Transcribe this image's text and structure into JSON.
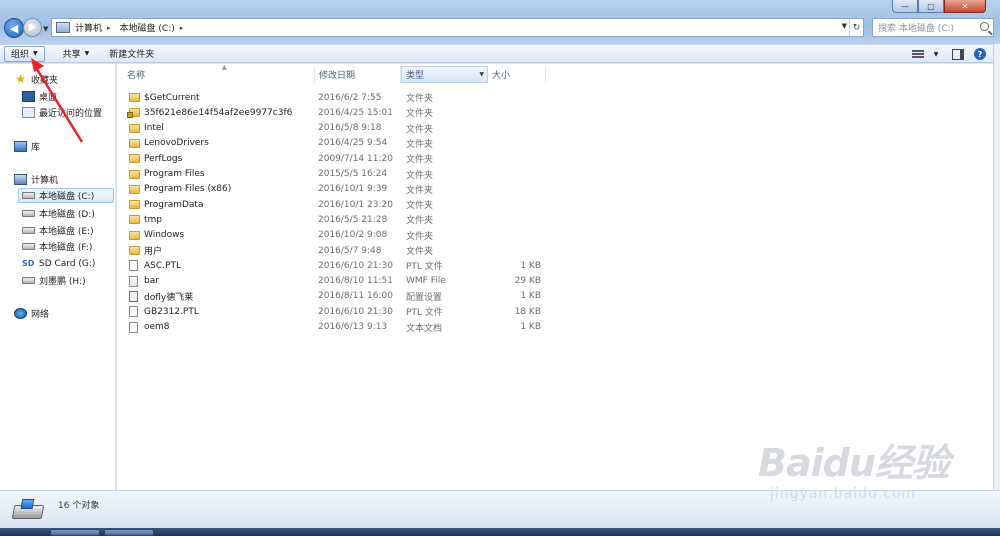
{
  "window": {
    "caption_min": "—",
    "caption_max": "□",
    "caption_close": "✕"
  },
  "nav": {
    "back": "◀",
    "forward": "▶",
    "dropdown": "▼"
  },
  "address": {
    "crumbs": [
      "计算机",
      "本地磁盘 (C:)"
    ],
    "separator": "▸",
    "dropdown": "▼",
    "refresh": "↻"
  },
  "search": {
    "placeholder": "搜索 本地磁盘 (C:)"
  },
  "toolbar": {
    "organize": "组织",
    "share": "共享",
    "new_folder": "新建文件夹",
    "caret": "▼",
    "help": "?"
  },
  "sidebar": {
    "favorites": "收藏夹",
    "desktop": "桌面",
    "recent": "最近访问的位置",
    "library": "库",
    "computer": "计算机",
    "drives": [
      "本地磁盘 (C:)",
      "本地磁盘 (D:)",
      "本地磁盘 (E:)",
      "本地磁盘 (F:)",
      "SD Card (G:)",
      "刘墨鹏 (H:)"
    ],
    "sd_mark": "SD",
    "network": "网络"
  },
  "columns": {
    "name": "名称",
    "date": "修改日期",
    "type": "类型",
    "size": "大小",
    "sort_indicator": "▲",
    "caret": "▼"
  },
  "files": [
    {
      "name": "$GetCurrent",
      "date": "2016/6/2 7:55",
      "type": "文件夹",
      "size": "",
      "kind": "folder"
    },
    {
      "name": "35f621e86e14f54af2ee9977c3f6",
      "date": "2016/4/25 15:01",
      "type": "文件夹",
      "size": "",
      "kind": "folder-lock"
    },
    {
      "name": "Intel",
      "date": "2016/5/8 9:18",
      "type": "文件夹",
      "size": "",
      "kind": "folder"
    },
    {
      "name": "LenovoDrivers",
      "date": "2016/4/25 9:54",
      "type": "文件夹",
      "size": "",
      "kind": "folder"
    },
    {
      "name": "PerfLogs",
      "date": "2009/7/14 11:20",
      "type": "文件夹",
      "size": "",
      "kind": "folder"
    },
    {
      "name": "Program Files",
      "date": "2015/5/5 16:24",
      "type": "文件夹",
      "size": "",
      "kind": "folder"
    },
    {
      "name": "Program Files (x86)",
      "date": "2016/10/1 9:39",
      "type": "文件夹",
      "size": "",
      "kind": "folder"
    },
    {
      "name": "ProgramData",
      "date": "2016/10/1 23:20",
      "type": "文件夹",
      "size": "",
      "kind": "folder"
    },
    {
      "name": "tmp",
      "date": "2016/5/5 21:28",
      "type": "文件夹",
      "size": "",
      "kind": "folder"
    },
    {
      "name": "Windows",
      "date": "2016/10/2 9:08",
      "type": "文件夹",
      "size": "",
      "kind": "folder"
    },
    {
      "name": "用户",
      "date": "2016/5/7 9:48",
      "type": "文件夹",
      "size": "",
      "kind": "folder"
    },
    {
      "name": "ASC.PTL",
      "date": "2016/6/10 21:30",
      "type": "PTL 文件",
      "size": "1 KB",
      "kind": "file"
    },
    {
      "name": "bar",
      "date": "2016/8/10 11:51",
      "type": "WMF File",
      "size": "29 KB",
      "kind": "wmf"
    },
    {
      "name": "dofly德飞莱",
      "date": "2016/8/11 16:00",
      "type": "配置设置",
      "size": "1 KB",
      "kind": "cfg"
    },
    {
      "name": "GB2312.PTL",
      "date": "2016/6/10 21:30",
      "type": "PTL 文件",
      "size": "18 KB",
      "kind": "file"
    },
    {
      "name": "oem8",
      "date": "2016/6/13 9:13",
      "type": "文本文档",
      "size": "1 KB",
      "kind": "file"
    }
  ],
  "status": {
    "count": "16 个对象"
  },
  "watermark": {
    "brand": "Baidu经验",
    "url": "jingyan.baidu.com"
  }
}
